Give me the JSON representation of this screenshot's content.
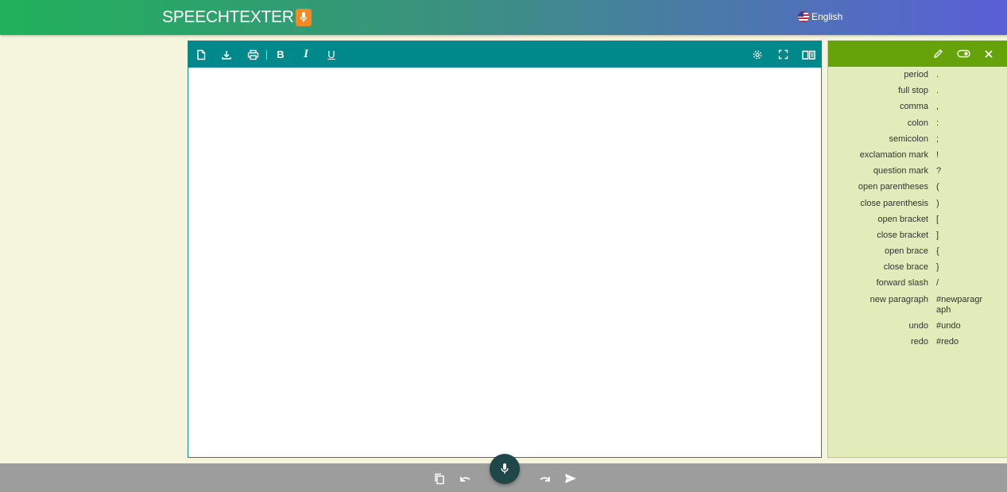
{
  "header": {
    "logo_text": "SPEECHTEXTER",
    "language": "English"
  },
  "toolbar": {
    "icons": [
      "new-document-icon",
      "download-icon",
      "print-icon",
      "bold-icon",
      "italic-icon",
      "underline-icon",
      "settings-icon",
      "fullscreen-icon",
      "reading-mode-icon"
    ],
    "bold_label": "B",
    "italic_label": "I",
    "underline_label": "U"
  },
  "editor": {
    "content": ""
  },
  "panel": {
    "icons": [
      "edit-icon",
      "toggle-icon",
      "close-icon"
    ],
    "commands": [
      {
        "name": "period",
        "value": "."
      },
      {
        "name": "full stop",
        "value": "."
      },
      {
        "name": "comma",
        "value": ","
      },
      {
        "name": "colon",
        "value": ":"
      },
      {
        "name": "semicolon",
        "value": ";"
      },
      {
        "name": "exclamation mark",
        "value": "!"
      },
      {
        "name": "question mark",
        "value": "?"
      },
      {
        "name": "open parentheses",
        "value": "("
      },
      {
        "name": "close parenthesis",
        "value": ")"
      },
      {
        "name": "open bracket",
        "value": "["
      },
      {
        "name": "close bracket",
        "value": "]"
      },
      {
        "name": "open brace",
        "value": "{"
      },
      {
        "name": "close brace",
        "value": "}"
      },
      {
        "name": "forward slash",
        "value": "/"
      },
      {
        "name": "new paragraph",
        "value": "#newparagraph"
      },
      {
        "name": "undo",
        "value": "#undo"
      },
      {
        "name": "redo",
        "value": "#redo"
      }
    ]
  },
  "footer": {
    "icons": [
      "copy-icon",
      "undo-icon",
      "microphone-icon",
      "redo-icon",
      "send-icon"
    ]
  },
  "colors": {
    "header_start": "#20b15a",
    "header_end": "#5b5fd8",
    "toolbar": "#00898a",
    "panel_header": "#66a30a",
    "panel_bg": "#e2ecba",
    "page_bg": "#f5f4dc",
    "footer": "#9d9d9d",
    "mic_button": "#1f4747",
    "logo_mic": "#f08a25"
  }
}
